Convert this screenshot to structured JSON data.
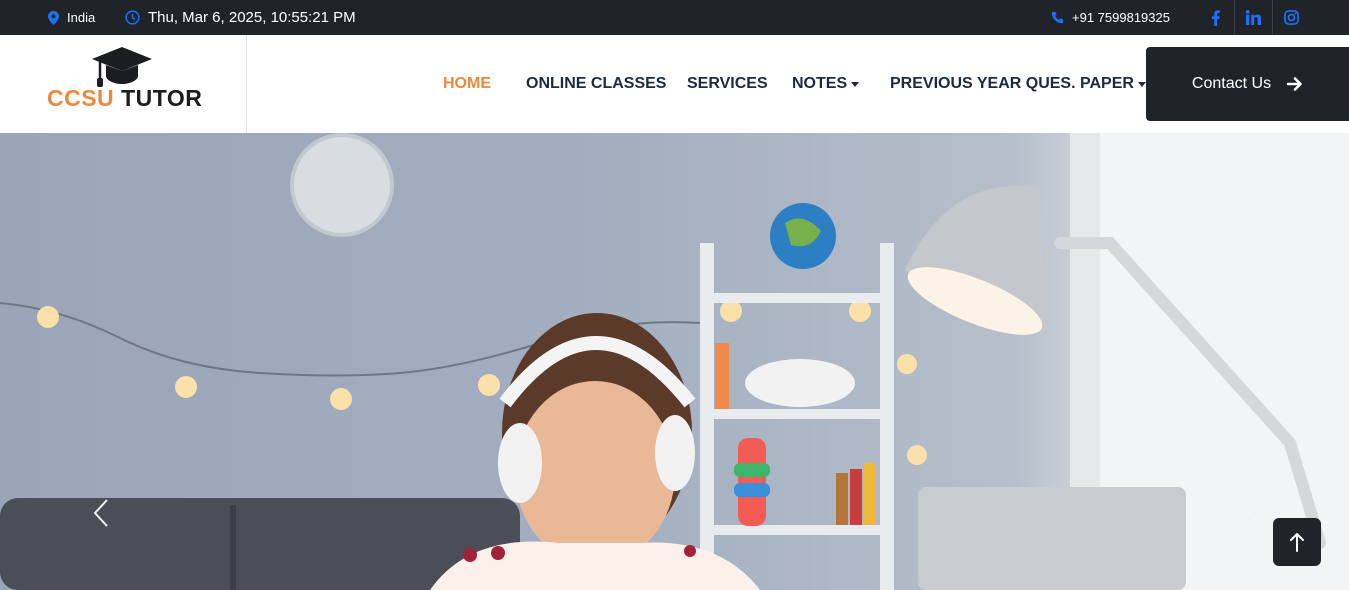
{
  "topbar": {
    "location": "India",
    "datetime": "Thu, Mar 6, 2025, 10:55:21 PM",
    "phone": "+91 7599819325",
    "social": [
      "f",
      "in",
      "ig"
    ]
  },
  "brand": {
    "part1": "CCSU",
    "part2": "TUTOR"
  },
  "nav": {
    "home": "HOME",
    "online_classes": "ONLINE CLASSES",
    "services": "SERVICES",
    "notes": "NOTES",
    "papers": "PREVIOUS YEAR QUES. PAPER"
  },
  "contact_label": "Contact Us",
  "colors": {
    "accent": "#f0883c",
    "dark": "#202429",
    "blue": "#1e6fff",
    "navy": "#1b2a45"
  },
  "hero": {
    "alt": "Smiling girl with headphones studying online"
  }
}
